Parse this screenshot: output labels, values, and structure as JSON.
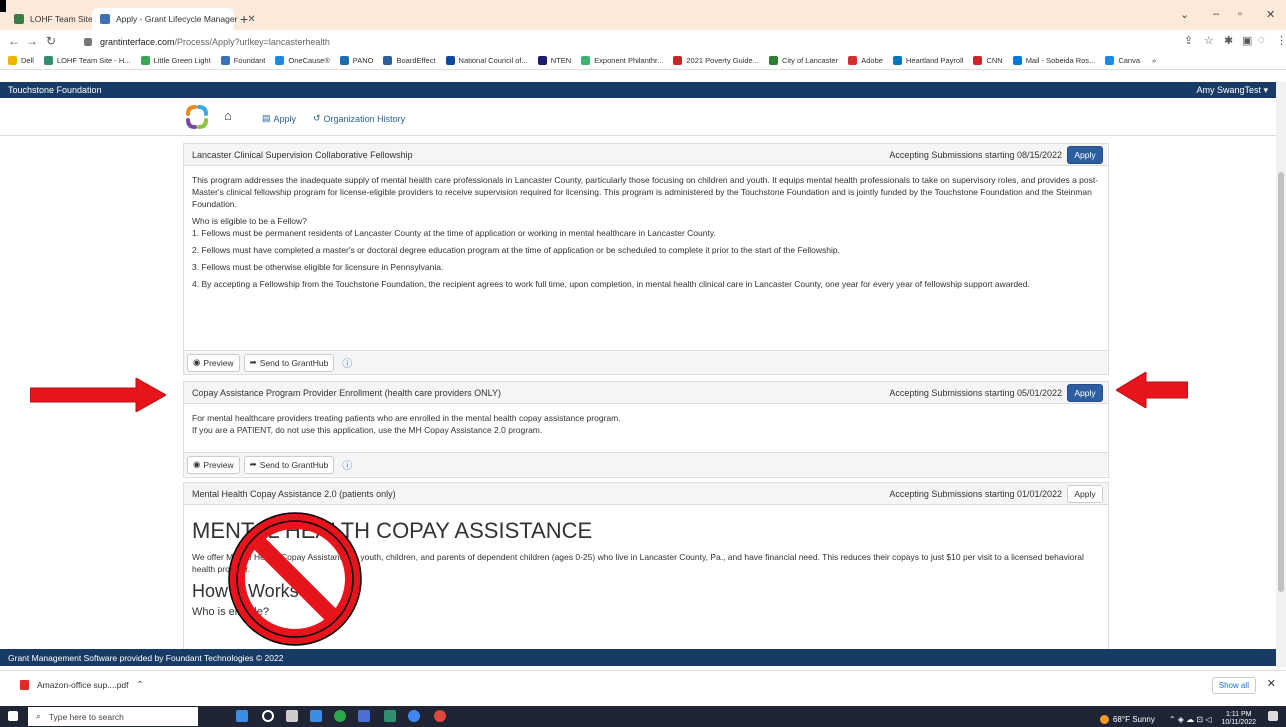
{
  "browser": {
    "tabs": [
      {
        "label": "LOHF Team Site - LOHF Files - Al",
        "active": false
      },
      {
        "label": "Apply - Grant Lifecycle Manager",
        "active": true
      }
    ],
    "new_tab_label": "+",
    "url_host": "grantinterface.com",
    "url_path": "/Process/Apply?urlkey=lancasterhealth",
    "bookmarks": [
      "Dell",
      "LOHF Team Site - H...",
      "Little Green Light",
      "Foundant",
      "OneCause®",
      "PANO",
      "BoardEffect",
      "National Council of...",
      "NTEN",
      "Exponent Philanthr...",
      "2021 Poverty Guide...",
      "City of Lancaster",
      "Adobe",
      "Heartland Payroll",
      "CNN",
      "Mail - Sobeida Ros...",
      "Canva"
    ],
    "bookmarks_more": "»"
  },
  "app": {
    "org_name": "Touchstone Foundation",
    "user_name": "Amy SwangTest ▾",
    "nav": {
      "apply": "Apply",
      "history": "Organization History"
    },
    "footer": "Grant Management Software provided by Foundant Technologies © 2022"
  },
  "programs": [
    {
      "title": "Lancaster Clinical Supervision Collaborative Fellowship",
      "accepting": "Accepting Submissions starting 08/15/2022",
      "apply_label": "Apply",
      "intro": "This program addresses the inadequate supply of mental health care professionals in Lancaster County, particularly those focusing on children and youth. It equips mental health professionals to take on supervisory roles, and provides a post-Master's clinical fellowship program for license-eligible providers to receive supervision required for licensing. This program is administered by the Touchstone Foundation and is jointly funded by the Touchstone Foundation and the Steinman Foundation.",
      "eligibility_q": "Who is eligible to be a Fellow?",
      "items": [
        "1. Fellows must be permanent residents of Lancaster County at the time of application or working in mental healthcare in Lancaster County.",
        "2. Fellows must have completed a master's or doctoral degree education program at the time of application or be scheduled to complete it prior to the start of the Fellowship.",
        "3. Fellows must be otherwise eligible for licensure in Pennsylvania.",
        "4. By accepting a Fellowship from the Touchstone Foundation, the recipient agrees to work full time, upon completion, in mental health clinical care in Lancaster County, one year for every year of fellowship support awarded."
      ],
      "preview_label": "Preview",
      "send_label": "Send to GrantHub"
    },
    {
      "title": "Copay Assistance Program Provider Enrollment (health care providers ONLY)",
      "accepting": "Accepting Submissions starting 05/01/2022",
      "apply_label": "Apply",
      "line1": "For mental healthcare providers treating patients who are enrolled in the mental health copay assistance program.",
      "line2": "If you are a PATIENT, do not use this application, use the MH Copay Assistance 2.0 program.",
      "preview_label": "Preview",
      "send_label": "Send to GrantHub"
    },
    {
      "title": "Mental Health Copay Assistance 2.0 (patients only)",
      "accepting": "Accepting Submissions starting 01/01/2022",
      "apply_label": "Apply",
      "heading": "MENTAL HEALTH COPAY ASSISTANCE",
      "body": "We offer Mental Health Copay Assistance to youth, children, and parents of dependent children (ages 0-25) who live in Lancaster County, Pa., and have financial need. This reduces their copays to just $10 per visit to a licensed behavioral health provider.",
      "subheading": "How It Works",
      "question": "Who is eligible?"
    }
  ],
  "downloads": {
    "file": "Amazon-office sup....pdf",
    "show_all": "Show all"
  },
  "taskbar": {
    "search_placeholder": "Type here to search",
    "weather": "68°F Sunny",
    "time": "1:11 PM",
    "date": "10/11/2022"
  },
  "colors": {
    "header_bg": "#183b66",
    "apply_primary": "#2d5fa0",
    "arrow_red": "#e8141b"
  }
}
